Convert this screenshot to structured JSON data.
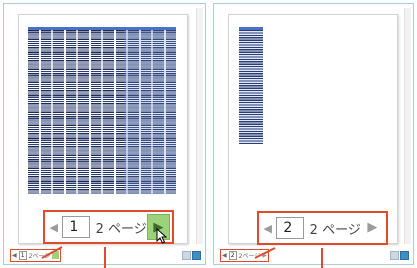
{
  "panes": [
    {
      "pager": {
        "page_value": "1",
        "page_label": "2 ページ"
      },
      "statusbar": {
        "page_value": "1",
        "page_label": "2ページ"
      }
    },
    {
      "pager": {
        "page_value": "2",
        "page_label": "2 ページ"
      },
      "statusbar": {
        "page_value": "2",
        "page_label": "2ページ"
      }
    }
  ],
  "icons": {
    "prev": "triangle-left-icon",
    "next": "triangle-right-icon",
    "cursor": "arrow-cursor-icon",
    "zoom": "zoom-view-icon"
  },
  "colors": {
    "callout": "#e04b2f",
    "next_highlight": "#9ed27a",
    "pane_border": "#aacbe0"
  }
}
